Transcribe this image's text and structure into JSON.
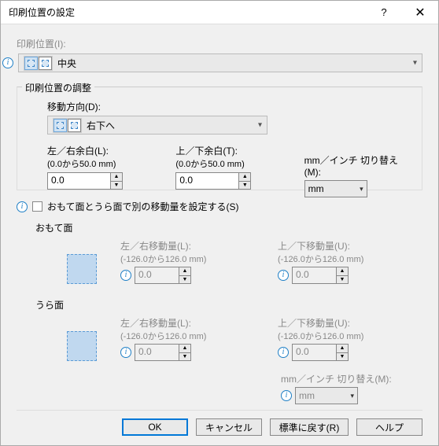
{
  "title": "印刷位置の設定",
  "section_pos_label": "印刷位置(I):",
  "pos_value": "中央",
  "fieldset_adjust": "印刷位置の調整",
  "move_dir_label": "移動方向(D):",
  "move_dir_value": "右下へ",
  "left_right_margin": {
    "label": "左／右余白(L):",
    "hint": "(0.0から50.0 mm)",
    "value": "0.0"
  },
  "top_bottom_margin": {
    "label": "上／下余白(T):",
    "hint": "(0.0から50.0 mm)",
    "value": "0.0"
  },
  "unit_switch_label": "mm／インチ 切り替え(M):",
  "unit_value": "mm",
  "per_side_checkbox_label": "おもて面とうら面で別の移動量を設定する(S)",
  "front": {
    "title": "おもて面",
    "lr": {
      "label": "左／右移動量(L):",
      "hint": "(-126.0から126.0 mm)",
      "value": "0.0"
    },
    "tb": {
      "label": "上／下移動量(U):",
      "hint": "(-126.0から126.0 mm)",
      "value": "0.0"
    }
  },
  "back": {
    "title": "うら面",
    "lr": {
      "label": "左／右移動量(L):",
      "hint": "(-126.0から126.0 mm)",
      "value": "0.0"
    },
    "tb": {
      "label": "上／下移動量(U):",
      "hint": "(-126.0から126.0 mm)",
      "value": "0.0"
    }
  },
  "unit_switch_label2": "mm／インチ 切り替え(M):",
  "unit_value2": "mm",
  "buttons": {
    "ok": "OK",
    "cancel": "キャンセル",
    "reset": "標準に戻す(R)",
    "help": "ヘルプ"
  }
}
